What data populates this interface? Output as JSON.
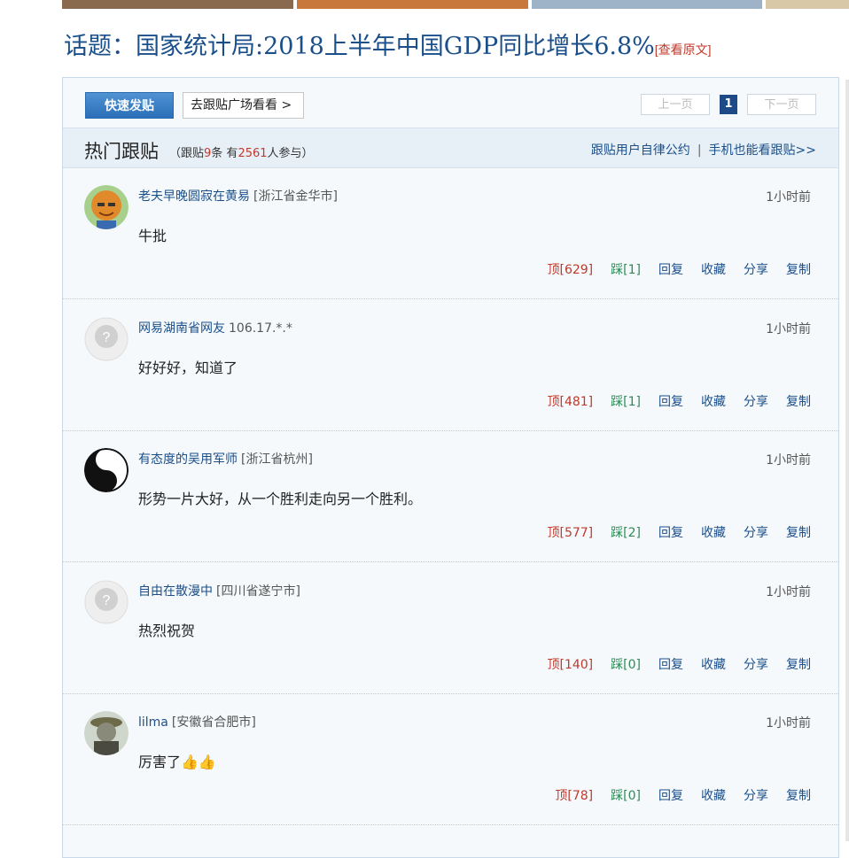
{
  "title": {
    "text": "话题：国家统计局:2018上半年中国GDP同比增长6.8%",
    "orig_link": "[查看原文]"
  },
  "toolbar": {
    "post_label": "快速发贴",
    "square_label": "去跟贴广场看看 >"
  },
  "pager": {
    "prev": "上一页",
    "current": "1",
    "next": "下一页"
  },
  "hot": {
    "title": "热门跟贴",
    "stats_pre": "（跟贴",
    "count": "9",
    "stats_mid": "条  有",
    "people": "2561",
    "stats_post": "人参与）",
    "link_rules": "跟贴用户自律公约",
    "link_mobile": "手机也能看跟贴>>"
  },
  "comments": [
    {
      "user": "老夫早晚圆寂在黄易",
      "loc": "[浙江省金华市]",
      "time": "1小时前",
      "text": "牛批",
      "up": "顶[629]",
      "down": "踩[1]"
    },
    {
      "user": "网易湖南省网友",
      "loc": "106.17.*.*",
      "time": "1小时前",
      "text": "好好好，知道了",
      "up": "顶[481]",
      "down": "踩[1]"
    },
    {
      "user": "有态度的吴用军师",
      "loc": "[浙江省杭州]",
      "time": "1小时前",
      "text": "形势一片大好，从一个胜利走向另一个胜利。",
      "up": "顶[577]",
      "down": "踩[2]"
    },
    {
      "user": "自由在散漫中",
      "loc": "[四川省遂宁市]",
      "time": "1小时前",
      "text": "热烈祝贺",
      "up": "顶[140]",
      "down": "踩[0]"
    },
    {
      "user": "lilma",
      "loc": "[安徽省合肥市]",
      "time": "1小时前",
      "text": "厉害了👍👍",
      "up": "顶[78]",
      "down": "踩[0]"
    }
  ],
  "actions": {
    "reply": "回复",
    "fav": "收藏",
    "share": "分享",
    "copy": "复制"
  },
  "colors": {
    "link": "#1b4f8a",
    "accent_red": "#c0392b",
    "accent_green": "#2e8b57",
    "panel_bg": "#f5f9fc"
  }
}
